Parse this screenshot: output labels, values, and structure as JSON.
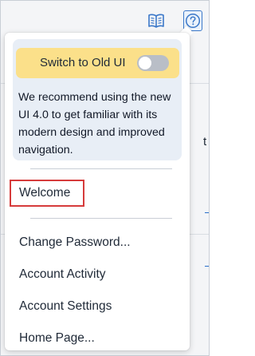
{
  "header": {
    "docs_icon": "book-open-icon",
    "help_icon": "question-circle-icon"
  },
  "background": {
    "partial_char": "t"
  },
  "menu": {
    "switch_label": "Switch to Old UI",
    "switch_on": false,
    "info_text": "We recommend using the new UI 4.0 to get familiar with its modern design and improved navigation.",
    "welcome_label": "Welcome",
    "items": [
      {
        "label": "Change Password..."
      },
      {
        "label": "Account Activity"
      },
      {
        "label": "Account Settings"
      },
      {
        "label": "Home Page..."
      }
    ]
  },
  "colors": {
    "accent": "#3b78c9",
    "switch_background": "#fbe08a",
    "card_background": "#e8eef6",
    "highlight_border": "#d63b3b"
  }
}
